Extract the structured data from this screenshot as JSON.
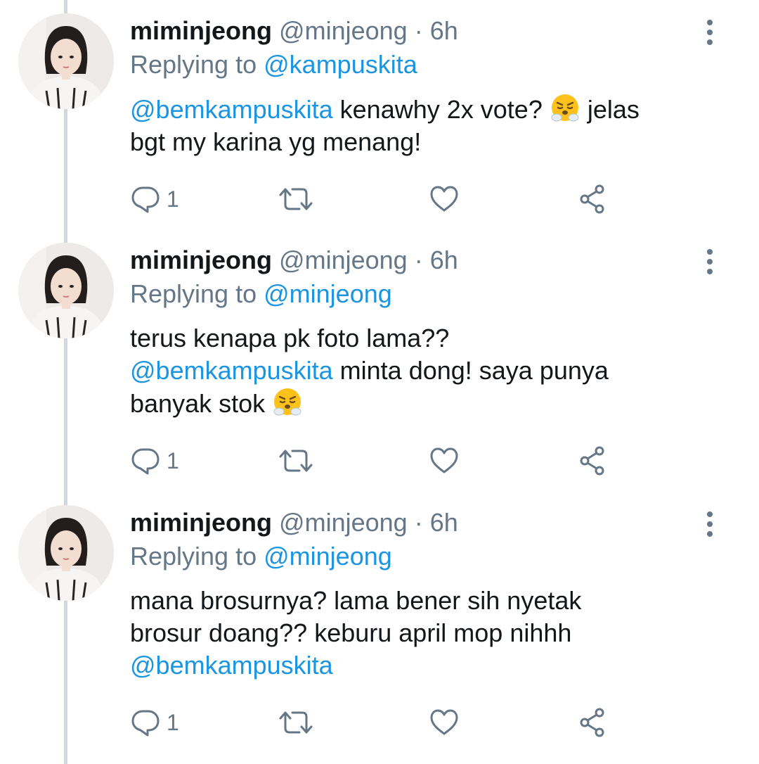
{
  "colors": {
    "link": "#1b95e0",
    "secondary_text": "#657786",
    "primary_text": "#14171a",
    "thread_line": "#cfd9de"
  },
  "icons": {
    "reply": "comment-bubble-icon",
    "retweet": "retweet-icon",
    "like": "heart-icon",
    "share": "share-icon",
    "more": "vertical-dots-icon",
    "emoji": "face-with-steam-from-nose"
  },
  "tweets": [
    {
      "display_name": "miminjeong",
      "handle": "@minjeong",
      "separator": "·",
      "time": "6h",
      "replying_label": "Replying to",
      "replying_to": "@kampuskita",
      "text": {
        "mention1": "@bemkampuskita",
        "part1": " kenawhy 2x vote? ",
        "part2": " jelas",
        "line2": "bgt my karina yg menang!"
      },
      "reply_count": "1"
    },
    {
      "display_name": "miminjeong",
      "handle": "@minjeong",
      "separator": "·",
      "time": "6h",
      "replying_label": "Replying to",
      "replying_to": "@minjeong",
      "text": {
        "line1": "terus kenapa pk foto lama??",
        "mention1": "@bemkampuskita",
        "line2_rest": " minta dong! saya punya",
        "line3": "banyak stok "
      },
      "reply_count": "1"
    },
    {
      "display_name": "miminjeong",
      "handle": "@minjeong",
      "separator": "·",
      "time": "6h",
      "replying_label": "Replying to",
      "replying_to": "@minjeong",
      "text": {
        "line1": "mana brosurnya? lama bener sih nyetak",
        "line2": "brosur doang?? keburu april mop nihhh",
        "mention1": "@bemkampuskita"
      },
      "reply_count": "1"
    }
  ]
}
